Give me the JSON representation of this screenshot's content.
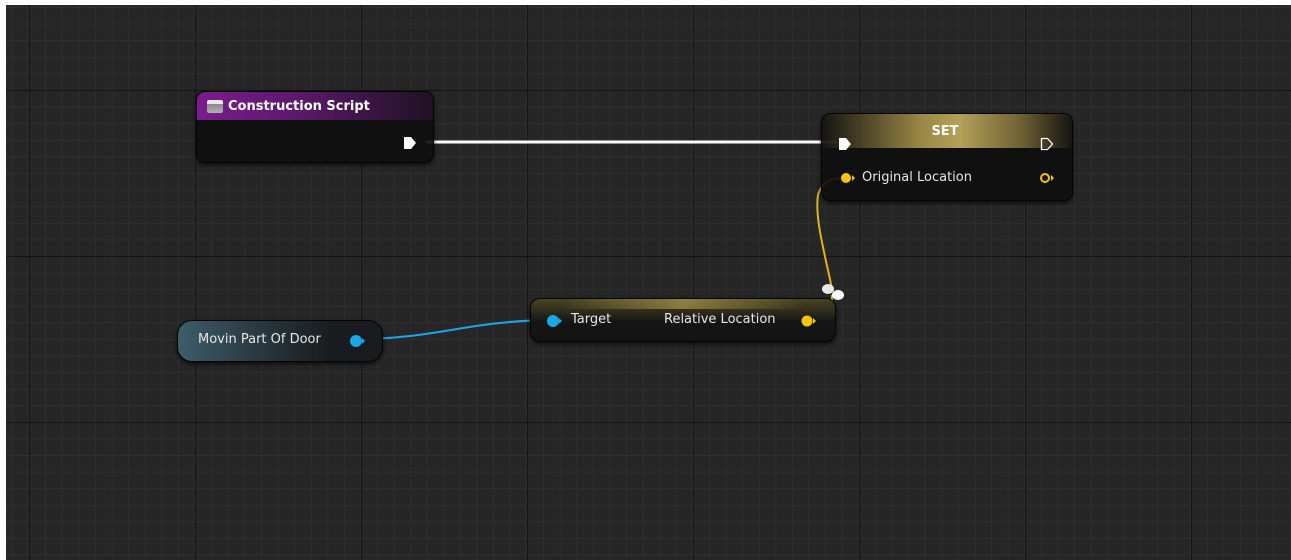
{
  "nodes": {
    "construction_script": {
      "title": "Construction Script"
    },
    "set_node": {
      "title": "SET",
      "pin_label": "Original Location"
    },
    "variable_get": {
      "label": "Movin Part Of Door"
    },
    "relative_location": {
      "input_label": "Target",
      "output_label": "Relative Location"
    }
  },
  "colors": {
    "graph_background": "#262626",
    "exec_wire": "#ffffff",
    "vector_pin": "#f5c500",
    "object_pin": "#1aa7e8",
    "function_header": "#7a1b8f"
  },
  "icons": {
    "function_entry": "function-icon",
    "exec": "exec-pin-icon",
    "reroute": "reroute-knot-icon"
  }
}
